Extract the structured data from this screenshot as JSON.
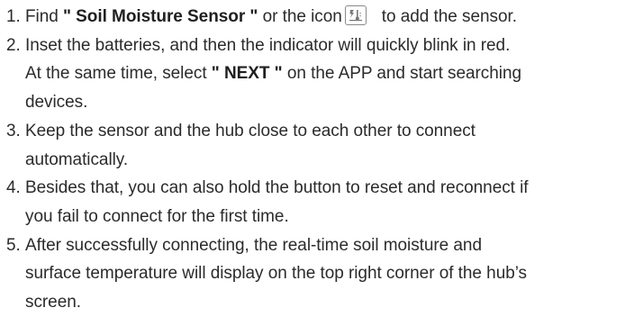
{
  "steps": [
    {
      "number": "1.",
      "t1": "Find ",
      "b1": "\" Soil Moisture Sensor \"",
      "t2": " or the icon",
      "icon": "soil-sensor-icon",
      "t3": "to add the sensor."
    },
    {
      "number": "2.",
      "l1": "Inset the batteries, and then the indicator will quickly blink in red.",
      "l2a": "At the same time, select ",
      "l2b": "\" NEXT \"",
      "l2c": " on the APP and start searching",
      "l3": "devices."
    },
    {
      "number": "3.",
      "l1": "Keep the sensor and the hub close to each other to connect",
      "l2": "automatically."
    },
    {
      "number": "4.",
      "l1": "Besides that, you can also hold the button to reset and reconnect if",
      "l2": "you fail to connect for the first time."
    },
    {
      "number": "5.",
      "l1": "After successfully connecting, the real-time soil moisture and",
      "l2": "surface temperature will display on the top right corner of the hub’s",
      "l3": "screen."
    }
  ]
}
